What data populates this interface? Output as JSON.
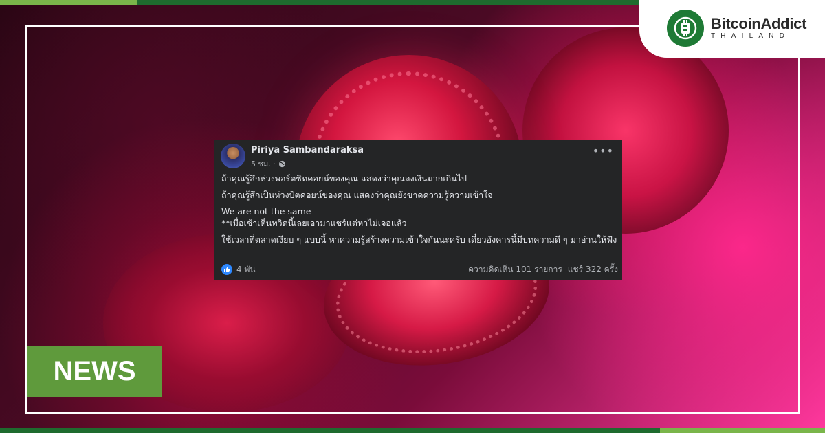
{
  "brand": {
    "name": "BitcoinAddict",
    "sub": "THAILAND"
  },
  "tag": "NEWS",
  "post": {
    "author": "Piriya Sambandaraksa",
    "time": "5 ชม. ·",
    "lines": [
      "ถ้าคุณรู้สึกห่วงพอร์ตชิทคอยน์ของคุณ แสดงว่าคุณลงเงินมากเกินไป",
      "ถ้าคุณรู้สึกเป็นห่วงบิตคอยน์ของคุณ แสดงว่าคุณยังขาดความรู้ความเข้าใจ"
    ],
    "line3a": "We are not the same",
    "line3b": "**เมื่อเช้าเห็นทวิตนี้เลยเอามาแชร์แต่หาไม่เจอแล้ว",
    "line4": "ใช้เวลาที่ตลาดเงียบ ๆ แบบนี้ หาความรู้สร้างความเข้าใจกันนะครับ เดี๋ยวอังคารนี้มีบทความดี ๆ มาอ่านให้ฟัง",
    "likes": "4 พัน",
    "comments": "ความคิดเห็น 101 รายการ",
    "shares": "แชร์ 322 ครั้ง"
  },
  "colors": {
    "brand_green": "#1e7a35",
    "news_green": "#5f9a3c",
    "post_bg": "#242526",
    "like_blue": "#2d88ff"
  },
  "icons": {
    "logo": "bitcoin-logo-icon",
    "globe": "globe-icon",
    "more": "more-icon",
    "like": "like-icon"
  }
}
